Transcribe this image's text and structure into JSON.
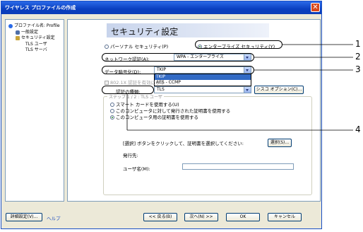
{
  "window": {
    "title": "ワイヤレス プロファイルの作成",
    "close_glyph": "✕"
  },
  "tree": {
    "items": [
      {
        "label": "プロファイル名: Profile",
        "icon": "globe-icon"
      },
      {
        "label": "一般設定",
        "icon": "users-icon"
      },
      {
        "label": "セキュリティ設定",
        "icon": "lock-icon"
      },
      {
        "label": "TLS ユーザ",
        "icon": ""
      },
      {
        "label": "TLS サーバ",
        "icon": ""
      }
    ]
  },
  "main": {
    "heading": "セキュリティ設定",
    "radio_personal": "パーソナル セキュリティ(P)",
    "radio_enterprise": "エンタープライズ セキュリティ(Y)",
    "network_auth_label": "ネットワーク認証(A):",
    "network_auth_value": "WPA - エンタープライズ",
    "encryption_label": "データ暗号化(D):",
    "encryption_value": "TKIP",
    "encryption_options": [
      "TKIP",
      "AES - CCMP"
    ],
    "dot1x_label": "802.1X 認証を有効にする",
    "auth_type_label": "認証の種類:",
    "auth_type_value": "TLS",
    "cisco_options_button": "シスコ オプション(C)...",
    "group_label": "ステップ 1 / 2 : TLS ユーザ",
    "cert_options": [
      "スマート カードを使用する(U)",
      "このコンピュータに対して発行された証明書を使用する",
      "このコンピュータ用の証明書を使用する"
    ],
    "select_instruction": "[選択] ボタンをクリックして、証明書を選択してください:",
    "select_button": "選択(S)...",
    "issuer_label": "発行先:",
    "username_label": "ユーザ名(M):",
    "username_value": ""
  },
  "footer": {
    "advanced_button": "詳細設定(V)...",
    "help_link": "ヘルプ",
    "back_button": "<< 戻る(B)",
    "next_button": "次へ(N) >>",
    "ok_button": "OK",
    "cancel_button": "キャンセル"
  },
  "callouts": [
    "1",
    "2",
    "3",
    "4"
  ],
  "colors": {
    "titlebar": "#0a3fc0",
    "close": "#d9481b",
    "selection": "#316ac5"
  }
}
